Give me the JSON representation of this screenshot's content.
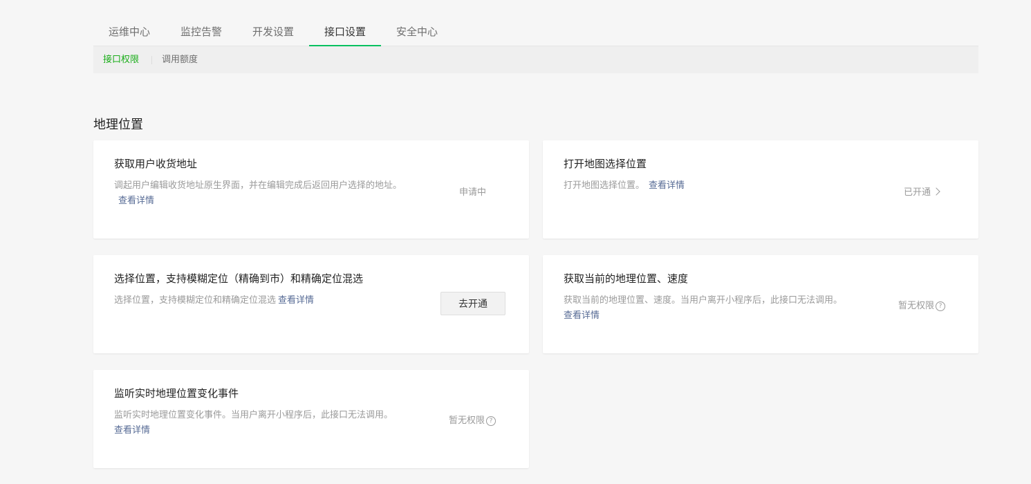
{
  "tabs": [
    {
      "label": "运维中心"
    },
    {
      "label": "监控告警"
    },
    {
      "label": "开发设置"
    },
    {
      "label": "接口设置",
      "active": true
    },
    {
      "label": "安全中心"
    }
  ],
  "subtabs": [
    {
      "label": "接口权限",
      "active": true
    },
    {
      "label": "调用额度"
    }
  ],
  "section": {
    "title": "地理位置"
  },
  "cards": [
    {
      "title": "获取用户收货地址",
      "desc": "调起用户编辑收货地址原生界面，并在编辑完成后返回用户选择的地址。",
      "link": "查看详情",
      "status": "申请中"
    },
    {
      "title": "打开地图选择位置",
      "desc": "打开地图选择位置。",
      "link": "查看详情",
      "status": "已开通"
    },
    {
      "title": "选择位置，支持模糊定位（精确到市）和精确定位混选",
      "desc": "选择位置，支持模糊定位和精确定位混选",
      "link": "查看详情",
      "button": "去开通"
    },
    {
      "title": "获取当前的地理位置、速度",
      "desc": "获取当前的地理位置、速度。当用户离开小程序后，此接口无法调用。",
      "link": "查看详情",
      "status": "暂无权限"
    },
    {
      "title": "监听实时地理位置变化事件",
      "desc": "监听实时地理位置变化事件。当用户离开小程序后，此接口无法调用。",
      "link": "查看详情",
      "status": "暂无权限"
    }
  ],
  "icons": {
    "chevron": "chevron-right-icon",
    "help": "question-circle-icon"
  },
  "colors": {
    "accent": "#07c160",
    "link": "#576b95"
  }
}
